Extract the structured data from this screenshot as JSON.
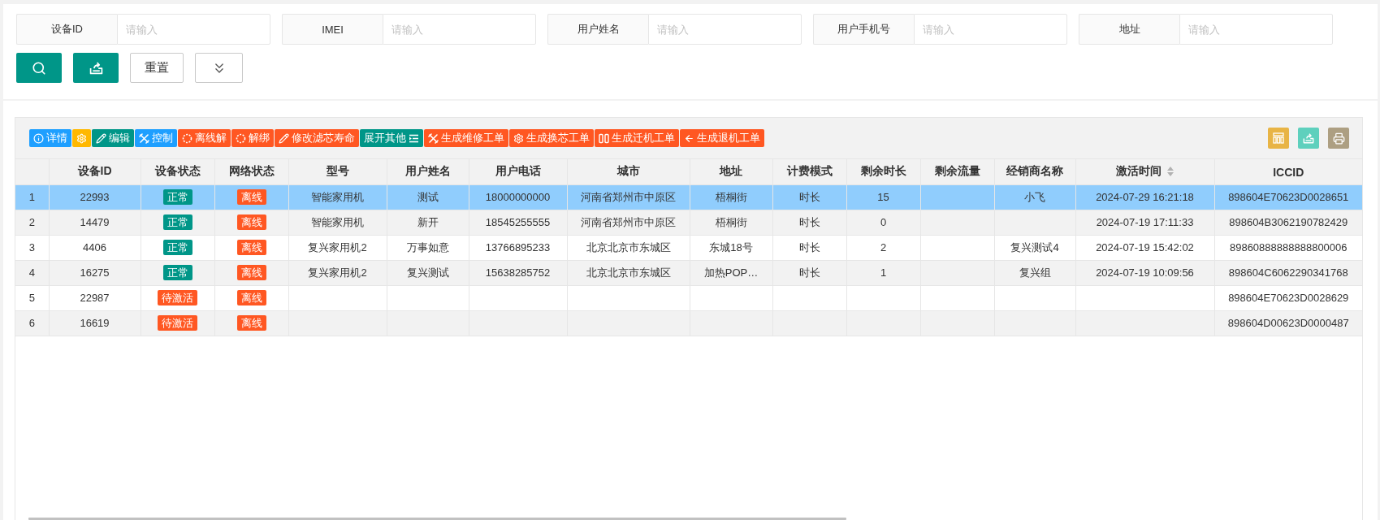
{
  "search_fields": [
    {
      "label": "设备ID",
      "placeholder": "请输入"
    },
    {
      "label": "IMEI",
      "placeholder": "请输入"
    },
    {
      "label": "用户姓名",
      "placeholder": "请输入"
    },
    {
      "label": "用户手机号",
      "placeholder": "请输入"
    },
    {
      "label": "地址",
      "placeholder": "请输入"
    }
  ],
  "search_buttons": {
    "reset_label": "重置"
  },
  "toolbar": {
    "buttons": [
      {
        "label": "详情",
        "color": "#1e9fff"
      },
      {
        "color": "#ffb800"
      },
      {
        "label": "编辑",
        "color": "#009688"
      },
      {
        "label": "控制",
        "color": "#1e9fff"
      },
      {
        "label": "离线解",
        "color": "#ff5722"
      },
      {
        "label": "解绑",
        "color": "#ff5722"
      },
      {
        "label": "修改滤芯寿命",
        "color": "#ff5722"
      },
      {
        "label": "展开其他",
        "color": "#009688"
      },
      {
        "label": "生成维修工单",
        "color": "#ff5722"
      },
      {
        "label": "生成换芯工单",
        "color": "#ff5722"
      },
      {
        "label": "生成迁机工单",
        "color": "#ff5722"
      },
      {
        "label": "生成退机工单",
        "color": "#ff5722"
      }
    ]
  },
  "table": {
    "columns": [
      {
        "title": "设备ID",
        "sortable": false
      },
      {
        "title": "设备状态",
        "sortable": false
      },
      {
        "title": "网络状态",
        "sortable": false
      },
      {
        "title": "型号",
        "sortable": false
      },
      {
        "title": "用户姓名",
        "sortable": false
      },
      {
        "title": "用户电话",
        "sortable": false
      },
      {
        "title": "城市",
        "sortable": false
      },
      {
        "title": "地址",
        "sortable": false
      },
      {
        "title": "计费模式",
        "sortable": false
      },
      {
        "title": "剩余时长",
        "sortable": false
      },
      {
        "title": "剩余流量",
        "sortable": false
      },
      {
        "title": "经销商名称",
        "sortable": false
      },
      {
        "title": "激活时间",
        "sortable": true
      },
      {
        "title": "ICCID",
        "sortable": false
      }
    ],
    "rows": [
      {
        "no": "1",
        "selected": true,
        "cells": [
          {
            "kind": "text",
            "text": "22993"
          },
          {
            "kind": "badge",
            "text": "正常",
            "color": "#009688"
          },
          {
            "kind": "badge",
            "text": "离线",
            "color": "#ff5722"
          },
          {
            "kind": "text",
            "text": "智能家用机"
          },
          {
            "kind": "text",
            "text": "测试"
          },
          {
            "kind": "text",
            "text": "18000000000"
          },
          {
            "kind": "text",
            "text": "河南省郑州市中原区"
          },
          {
            "kind": "text",
            "text": "梧桐街"
          },
          {
            "kind": "text",
            "text": "时长"
          },
          {
            "kind": "text",
            "text": "15"
          },
          {
            "kind": "empty"
          },
          {
            "kind": "text",
            "text": "小飞"
          },
          {
            "kind": "text",
            "text": "2024-07-29 16:21:18"
          },
          {
            "kind": "text",
            "text": "898604E70623D0028651"
          }
        ]
      },
      {
        "no": "2",
        "selected": false,
        "cells": [
          {
            "kind": "text",
            "text": "14479"
          },
          {
            "kind": "badge",
            "text": "正常",
            "color": "#009688"
          },
          {
            "kind": "badge",
            "text": "离线",
            "color": "#ff5722"
          },
          {
            "kind": "text",
            "text": "智能家用机"
          },
          {
            "kind": "text",
            "text": "新开"
          },
          {
            "kind": "text",
            "text": "18545255555"
          },
          {
            "kind": "text",
            "text": "河南省郑州市中原区"
          },
          {
            "kind": "text",
            "text": "梧桐街"
          },
          {
            "kind": "text",
            "text": "时长"
          },
          {
            "kind": "text",
            "text": "0"
          },
          {
            "kind": "empty"
          },
          {
            "kind": "empty"
          },
          {
            "kind": "text",
            "text": "2024-07-19 17:11:33"
          },
          {
            "kind": "text",
            "text": "898604B3062190782429"
          }
        ]
      },
      {
        "no": "3",
        "selected": false,
        "cells": [
          {
            "kind": "text",
            "text": "4406"
          },
          {
            "kind": "badge",
            "text": "正常",
            "color": "#009688"
          },
          {
            "kind": "badge",
            "text": "离线",
            "color": "#ff5722"
          },
          {
            "kind": "text",
            "text": "复兴家用机2"
          },
          {
            "kind": "text",
            "text": "万事如意"
          },
          {
            "kind": "text",
            "text": "13766895233"
          },
          {
            "kind": "text",
            "text": "北京北京市东城区"
          },
          {
            "kind": "text",
            "text": "东城18号"
          },
          {
            "kind": "text",
            "text": "时长"
          },
          {
            "kind": "text",
            "text": "2"
          },
          {
            "kind": "empty"
          },
          {
            "kind": "text",
            "text": "复兴测试4"
          },
          {
            "kind": "text",
            "text": "2024-07-19 15:42:02"
          },
          {
            "kind": "text",
            "text": "89860888888888800006"
          }
        ]
      },
      {
        "no": "4",
        "selected": false,
        "cells": [
          {
            "kind": "text",
            "text": "16275"
          },
          {
            "kind": "badge",
            "text": "正常",
            "color": "#009688"
          },
          {
            "kind": "badge",
            "text": "离线",
            "color": "#ff5722"
          },
          {
            "kind": "text",
            "text": "复兴家用机2"
          },
          {
            "kind": "text",
            "text": "复兴测试"
          },
          {
            "kind": "text",
            "text": "15638285752"
          },
          {
            "kind": "text",
            "text": "北京北京市东城区"
          },
          {
            "kind": "text",
            "text": "加热POP…"
          },
          {
            "kind": "text",
            "text": "时长"
          },
          {
            "kind": "text",
            "text": "1"
          },
          {
            "kind": "empty"
          },
          {
            "kind": "text",
            "text": "复兴组"
          },
          {
            "kind": "text",
            "text": "2024-07-19 10:09:56"
          },
          {
            "kind": "text",
            "text": "898604C6062290341768"
          }
        ]
      },
      {
        "no": "5",
        "selected": false,
        "cells": [
          {
            "kind": "text",
            "text": "22987"
          },
          {
            "kind": "badge",
            "text": "待激活",
            "color": "#ff5722"
          },
          {
            "kind": "badge",
            "text": "离线",
            "color": "#ff5722"
          },
          {
            "kind": "empty"
          },
          {
            "kind": "empty"
          },
          {
            "kind": "empty"
          },
          {
            "kind": "empty"
          },
          {
            "kind": "empty"
          },
          {
            "kind": "empty"
          },
          {
            "kind": "empty"
          },
          {
            "kind": "empty"
          },
          {
            "kind": "empty"
          },
          {
            "kind": "empty"
          },
          {
            "kind": "text",
            "text": "898604E70623D0028629"
          }
        ]
      },
      {
        "no": "6",
        "selected": false,
        "cells": [
          {
            "kind": "text",
            "text": "16619"
          },
          {
            "kind": "badge",
            "text": "待激活",
            "color": "#ff5722"
          },
          {
            "kind": "badge",
            "text": "离线",
            "color": "#ff5722"
          },
          {
            "kind": "empty"
          },
          {
            "kind": "empty"
          },
          {
            "kind": "empty"
          },
          {
            "kind": "empty"
          },
          {
            "kind": "empty"
          },
          {
            "kind": "empty"
          },
          {
            "kind": "empty"
          },
          {
            "kind": "empty"
          },
          {
            "kind": "empty"
          },
          {
            "kind": "empty"
          },
          {
            "kind": "text",
            "text": "898604D00623D0000487"
          }
        ]
      }
    ]
  }
}
